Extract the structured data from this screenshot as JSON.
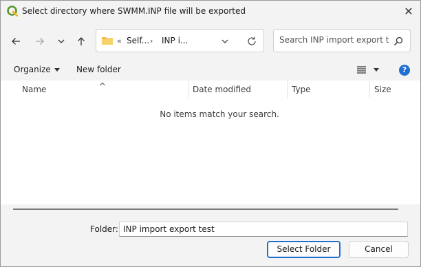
{
  "window": {
    "title": "Select directory where SWMM.INP file will be exported",
    "close_glyph": "✕"
  },
  "address": {
    "overflow_glyph": "«",
    "crumbs": [
      "Self...",
      "INP i..."
    ],
    "separator": "›"
  },
  "search": {
    "placeholder": "Search INP import export test"
  },
  "toolbar": {
    "organize_label": "Organize",
    "new_folder_label": "New folder",
    "help_glyph": "?"
  },
  "columns": [
    "Name",
    "Date modified",
    "Type",
    "Size"
  ],
  "file_list": {
    "empty_message": "No items match your search."
  },
  "footer": {
    "folder_label": "Folder:",
    "folder_value": "INP import export test",
    "select_button": "Select Folder",
    "cancel_button": "Cancel"
  },
  "icons": {
    "app": "qgis-icon",
    "back": "arrow-left-icon",
    "forward": "arrow-right-icon",
    "recent": "chevron-down-icon",
    "up": "arrow-up-icon",
    "folder": "folder-icon",
    "refresh": "refresh-icon",
    "search": "search-icon",
    "view": "list-view-icon",
    "help": "help-icon"
  },
  "colors": {
    "accent": "#1e6fd0",
    "folder_yellow": "#f2c04a",
    "qgis_green": "#589632"
  }
}
